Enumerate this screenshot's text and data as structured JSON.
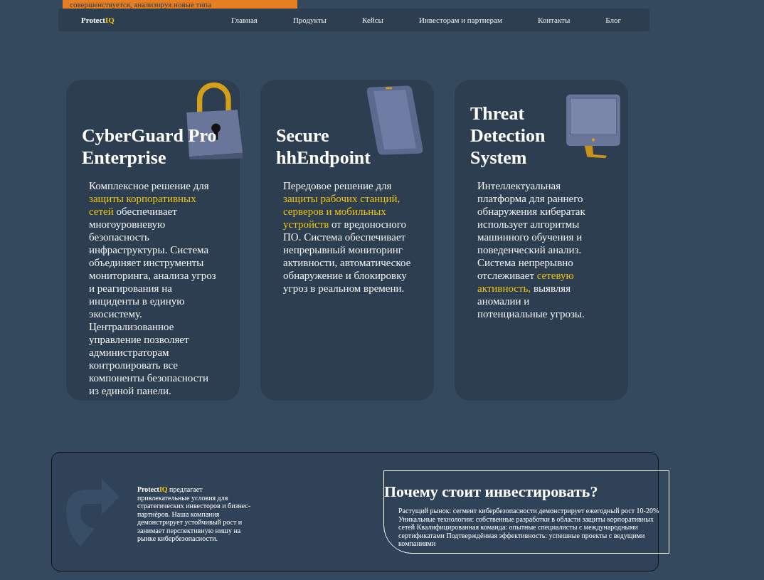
{
  "banner": {
    "text": "совершенствуется, анализируя новые типа"
  },
  "nav": {
    "logo": {
      "name": "Protect",
      "accent": "IQ"
    },
    "links": [
      "Главная",
      "Продукты",
      "Кейсы",
      "Инвесторам и партнерам",
      "Контакты",
      "Блог"
    ]
  },
  "cards": [
    {
      "kind": "lock",
      "title": "CyberGuard Pro Enterprise",
      "description": [
        {
          "text": "Комплексное решение для ",
          "highlight": false
        },
        {
          "text": "защиты корпоративных сетей",
          "highlight": true
        },
        {
          "text": " обеспечивает многоуровневую безопасность инфраструктуры. Система объединяет инструменты мониторинга, анализа угроз и реагирования на инциденты в единую экосистему. Централизованное управление позволяет администраторам контролировать все компоненты безопасности из единой панели.",
          "highlight": false
        }
      ]
    },
    {
      "kind": "phone",
      "title": "Secure hhEndpoint",
      "description": [
        {
          "text": "Передовое решение для ",
          "highlight": false
        },
        {
          "text": "защиты рабочих станций, серверов и мобильных устройств",
          "highlight": true
        },
        {
          "text": " от вредоносного ПО. Система обеспечивает непрерывный мониторинг активности, автоматическое обнаружение и блокировку угроз в реальном времени.",
          "highlight": false
        }
      ]
    },
    {
      "kind": "monitor",
      "title": "Threat Detection System",
      "description": [
        {
          "text": "Интеллектуальная платформа для раннего обнаружения кибератак использует алгоритмы машинного обучения и поведенческий анализ. Система непрерывно отслеживает ",
          "highlight": false
        },
        {
          "text": "сетевую активность,",
          "highlight": true
        },
        {
          "text": " выявляя аномалии и потенциальные угрозы.",
          "highlight": false
        }
      ]
    }
  ],
  "investors": {
    "brand": {
      "name": "Protect",
      "accent": "IQ"
    },
    "text": " предлагает привлекательные условия для стратегических инвесторов и бизнес-партнёров. Наша компания демонстрирует устойчивый рост и занимает перспективную нишу на рынке кибербезопасности.",
    "why": {
      "title": "Почему стоит инвестировать?",
      "text": "Растущий рынок: сегмент кибербезопасности демонстрирует ежегодный рост 10-20% Уникальные технологии: собственные разработки в области защиты корпоративных сетей Квалифицированная команда: опытные специалисты с международными сертификатами Подтверждённая эффективность: успешные проекты с ведущими компаниями"
    }
  }
}
